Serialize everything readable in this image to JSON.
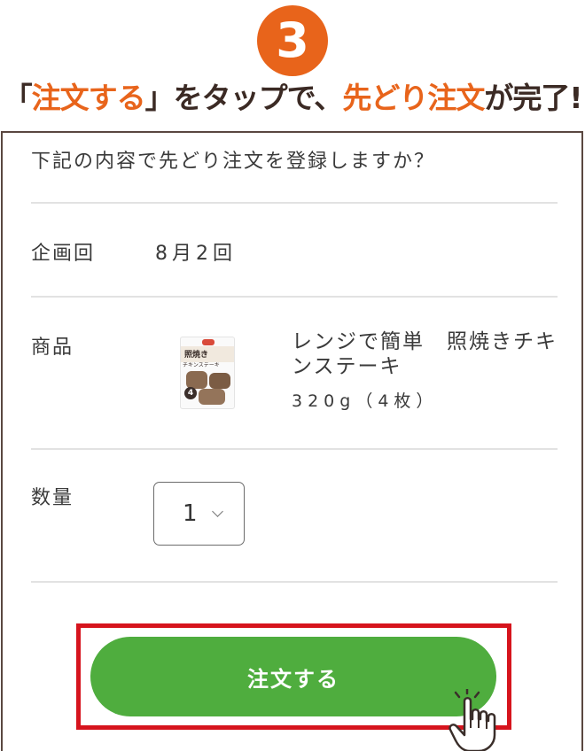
{
  "step": {
    "number": "3"
  },
  "headline": {
    "open_bracket": "「",
    "action": "注文する",
    "close_bracket": "」",
    "middle": "をタップで、",
    "feature": "先どり注文",
    "end": "が完了!"
  },
  "dialog": {
    "prompt": "下記の内容で先どり注文を登録しますか？",
    "round_label": "企画回",
    "round_value": "8月2回",
    "product_label": "商品",
    "product_name": "レンジで簡単　照焼きチキンステーキ",
    "product_size": "320g（4枚）",
    "thumbnail_title": "照焼き",
    "thumbnail_subtitle": "チキンステーキ",
    "thumbnail_count": "4",
    "quantity_label": "数量",
    "quantity_value": "1",
    "order_button": "注文する"
  },
  "colors": {
    "accent": "#e8641b",
    "button": "#4fad3e",
    "highlight": "#d6141d",
    "text": "#3a3a3a"
  },
  "icons": {
    "hand": "pointing-hand-icon",
    "chevron": "chevron-down-icon"
  }
}
